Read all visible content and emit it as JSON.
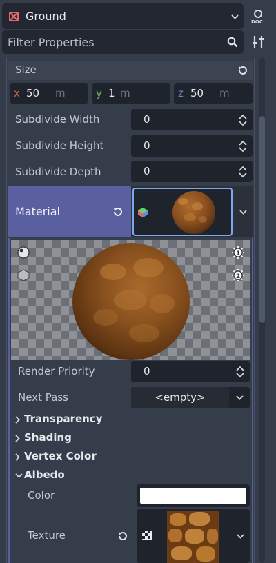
{
  "header": {
    "node_name": "Ground"
  },
  "filter": {
    "placeholder": "Filter Properties"
  },
  "size": {
    "label": "Size",
    "x_axis": "x",
    "x_value": "50",
    "x_unit": "m",
    "y_axis": "y",
    "y_value": "1",
    "y_unit": "m",
    "z_axis": "z",
    "z_value": "50",
    "z_unit": "m"
  },
  "properties": [
    {
      "label": "Subdivide Width",
      "value": "0"
    },
    {
      "label": "Subdivide Height",
      "value": "0"
    },
    {
      "label": "Subdivide Depth",
      "value": "0"
    }
  ],
  "material": {
    "label": "Material"
  },
  "material_props": {
    "render_priority_label": "Render Priority",
    "render_priority_value": "0",
    "next_pass_label": "Next Pass",
    "next_pass_value": "<empty>"
  },
  "sections": [
    "Transparency",
    "Shading",
    "Vertex Color"
  ],
  "albedo": {
    "title": "Albedo",
    "color_label": "Color",
    "color_value": "#ffffff",
    "texture_label": "Texture"
  },
  "colors": {
    "accent": "#5a5fa0",
    "highlight": "#7aa8e8",
    "background": "#363d4a"
  }
}
